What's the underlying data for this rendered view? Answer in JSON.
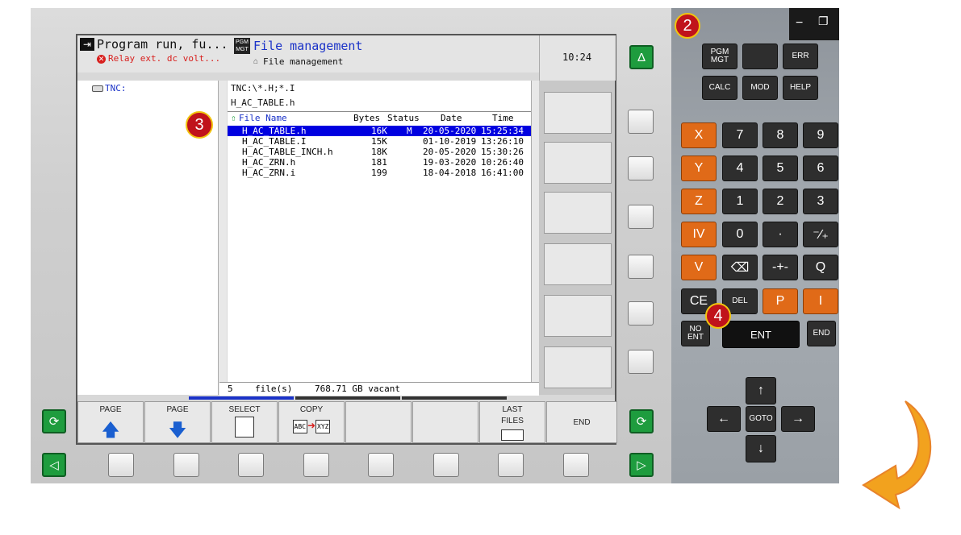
{
  "header": {
    "left_title": "Program run, fu...",
    "left_subtitle": "Relay ext. dc volt...",
    "pgm_icon_text": "PGM MGT",
    "right_title": "File management",
    "right_subtitle": "File management",
    "clock": "10:24"
  },
  "tree": {
    "drive": "TNC:"
  },
  "filepanel": {
    "path": "TNC:\\*.H;*.I",
    "current_file": "H_AC_TABLE.h",
    "columns": {
      "name": "File Name",
      "bytes": "Bytes",
      "status": "Status",
      "date": "Date",
      "time": "Time"
    },
    "files": [
      {
        "name": "H_AC_TABLE.h",
        "bytes": "16K",
        "status": "M",
        "date": "20-05-2020",
        "time": "15:25:34",
        "selected": true
      },
      {
        "name": "H_AC_TABLE.I",
        "bytes": "15K",
        "status": "",
        "date": "01-10-2019",
        "time": "13:26:10",
        "selected": false
      },
      {
        "name": "H_AC_TABLE_INCH.h",
        "bytes": "18K",
        "status": "",
        "date": "20-05-2020",
        "time": "15:30:26",
        "selected": false
      },
      {
        "name": "H_AC_ZRN.h",
        "bytes": "181",
        "status": "",
        "date": "19-03-2020",
        "time": "10:26:40",
        "selected": false
      },
      {
        "name": "H_AC_ZRN.i",
        "bytes": "199",
        "status": "",
        "date": "18-04-2018",
        "time": "16:41:00",
        "selected": false
      }
    ],
    "footer_count": "5",
    "footer_label": "file(s)",
    "footer_free": "768.71 GB vacant"
  },
  "softkeys": [
    {
      "label": "PAGE",
      "icon": "arrow-up-icon"
    },
    {
      "label": "PAGE",
      "icon": "arrow-down-icon"
    },
    {
      "label": "SELECT",
      "icon": "select-file-icon"
    },
    {
      "label": "COPY",
      "icon": "copy-abc-xyz-icon",
      "sub1": "ABC",
      "sub2": "XYZ"
    },
    {
      "label": "",
      "icon": ""
    },
    {
      "label": "",
      "icon": ""
    },
    {
      "label": "LAST",
      "label2": "FILES",
      "icon": "last-files-icon"
    },
    {
      "label": "END",
      "icon": ""
    }
  ],
  "keypad": {
    "row1": [
      "PGM MGT",
      "",
      "ERR"
    ],
    "row2": [
      "CALC",
      "MOD",
      "HELP"
    ],
    "axes": [
      "X",
      "Y",
      "Z",
      "IV",
      "V"
    ],
    "digits": [
      [
        "7",
        "8",
        "9"
      ],
      [
        "4",
        "5",
        "6"
      ],
      [
        "1",
        "2",
        "3"
      ],
      [
        "0",
        "·",
        "⁻∕₊"
      ]
    ],
    "row_q": [
      "⌫",
      "-+-",
      "Q"
    ],
    "row_ce": [
      "CE",
      "DEL",
      "P",
      "I"
    ],
    "row_ent": [
      "NO ENT",
      "ENT",
      "END"
    ],
    "goto": "GOTO",
    "arrows": {
      "up": "↑",
      "down": "↓",
      "left": "←",
      "right": "→"
    }
  },
  "window_controls": {
    "minimize": "−",
    "restore": "❐"
  },
  "nav_buttons": {
    "triangle_up": "Δ",
    "cycle": "⟳",
    "left": "◁",
    "right": "▷"
  },
  "badges": [
    "2",
    "3",
    "4"
  ],
  "colors": {
    "selection": "#0000e0",
    "accent_green": "#1e9c3e",
    "orange": "#e06a18",
    "badge_red": "#c0131b"
  }
}
